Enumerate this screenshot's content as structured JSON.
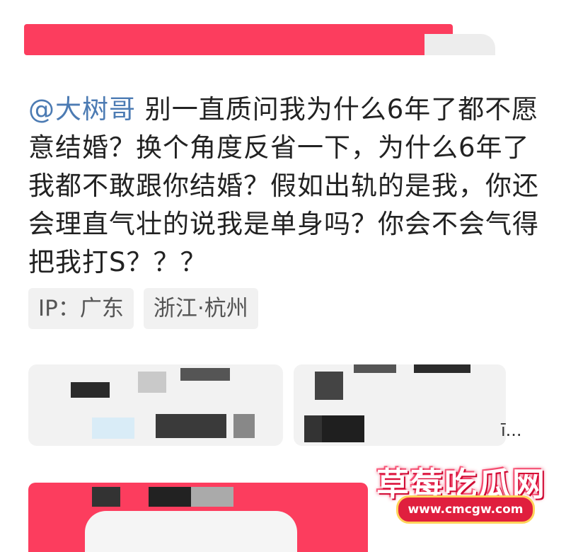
{
  "post": {
    "mention": "@大树哥",
    "body": " 别一直质问我为什么6年了都不愿意结婚？换个角度反省一下，为什么6年了我都不敢跟你结婚？假如出轨的是我，你还会理直气壮的说我是单身吗？你会不会气得把我打S？？？"
  },
  "tags": {
    "ip": "IP：广东",
    "location": "浙江·杭州"
  },
  "watermark": {
    "title": "草莓吃瓜网",
    "url": "www.cmcgw.com"
  },
  "more_indicator": "ī..."
}
